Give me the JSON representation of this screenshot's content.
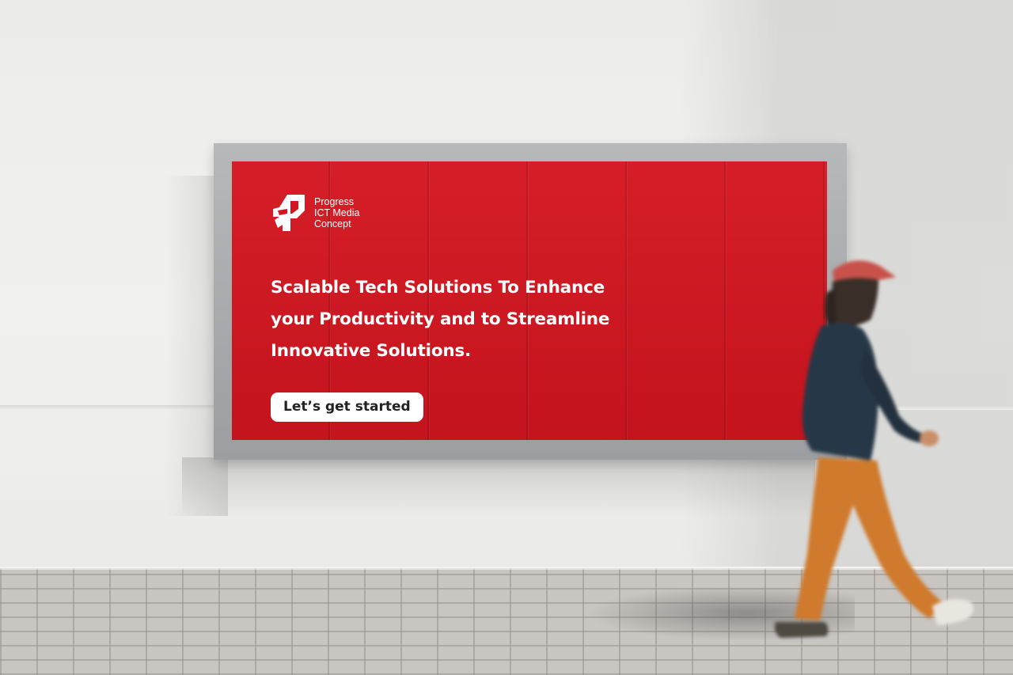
{
  "scene": {
    "description_colors": {
      "wall": "#ececea",
      "poster": "#d4151f",
      "frame": "#a9abae",
      "pavement": "#c9c5c1"
    }
  },
  "billboard": {
    "logo": {
      "icon": "progress-logo-icon",
      "lines": [
        "Progress",
        "ICT Media",
        "Concept"
      ]
    },
    "headline_lines": [
      "Scalable Tech Solutions To Enhance",
      "your Productivity and to Streamline",
      "Innovative Solutions."
    ],
    "cta_label": "Let’s get started"
  }
}
